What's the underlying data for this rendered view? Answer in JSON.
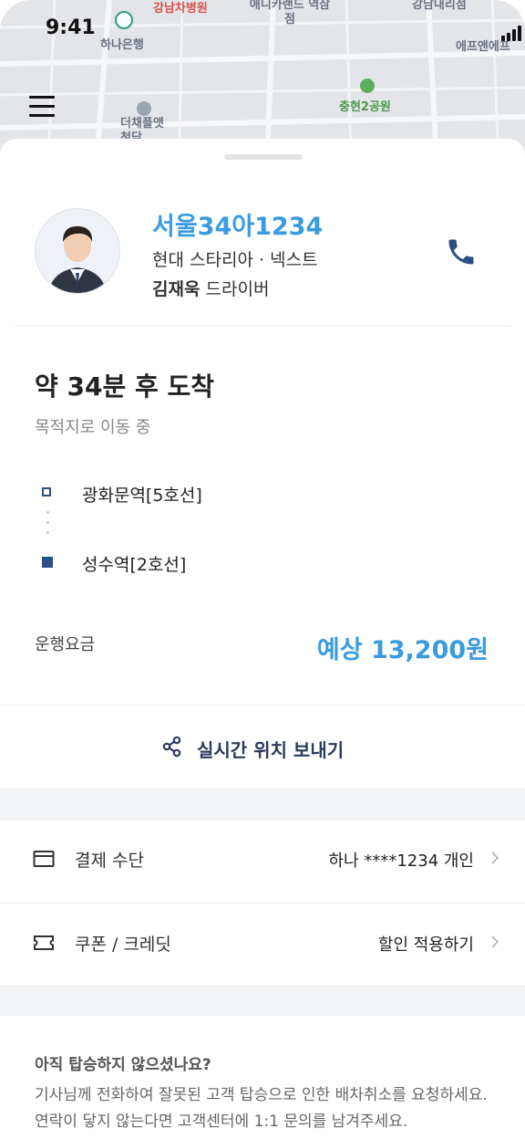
{
  "status_bar": {
    "time": "9:41"
  },
  "map": {
    "labels": [
      "강남차병원",
      "하나은행",
      "애니카랜드 역삼점",
      "강남내리점",
      "에프앤에프",
      "충현2공원",
      "더채플앳 청담"
    ]
  },
  "driver": {
    "plate": "서울34아1234",
    "car_model": "현대 스타리아 · 넥스트",
    "name": "김재욱",
    "role": "드라이버"
  },
  "trip": {
    "eta": "약 34분 후 도착",
    "status": "목적지로 이동 중",
    "origin": "광화문역[5호선]",
    "destination": "성수역[2호선]",
    "fare_label": "운행요금",
    "fare_value": "예상 13,200원"
  },
  "share": {
    "label": "실시간 위치 보내기"
  },
  "payment": {
    "label": "결제 수단",
    "value": "하나 ****1234 개인"
  },
  "coupon": {
    "label": "쿠폰 / 크레딧",
    "value": "할인 적용하기"
  },
  "notice": {
    "title": "아직 탑승하지 않으셨나요?",
    "body": "기사님께 전화하여 잘못된 고객 탑승으로 인한 배차취소를 요청하세요. 연락이 닿지 않는다면 고객센터에 1:1 문의를 남겨주세요."
  },
  "colors": {
    "accent": "#3a9be0",
    "navy": "#2d4f85",
    "text": "#222222"
  }
}
